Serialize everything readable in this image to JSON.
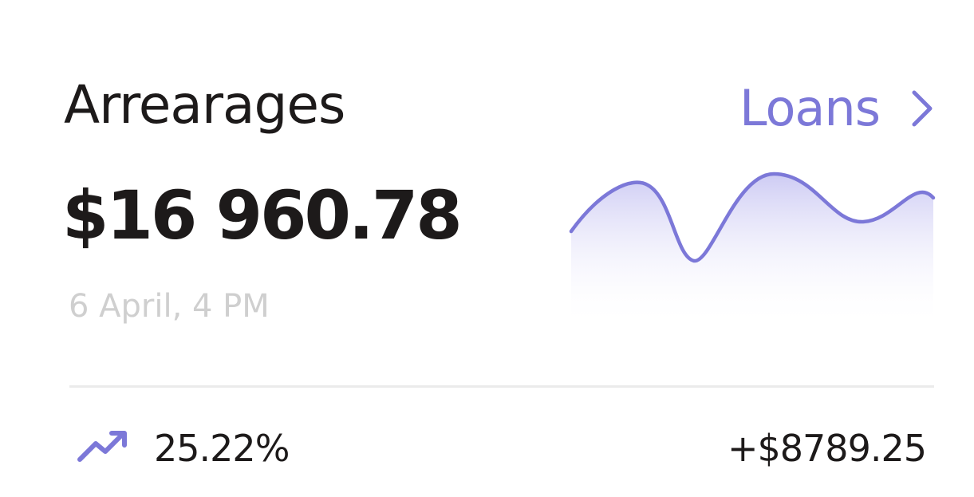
{
  "card": {
    "title": "Arrearages",
    "link_label": "Loans",
    "link_icon": "chevron-right-icon",
    "amount": "$16 960.78",
    "timestamp": "6 April, 4 PM",
    "change_icon": "trending-up-icon",
    "change_percent": "25.22%",
    "change_amount": "+$8789.25"
  },
  "colors": {
    "accent": "#7c78d8",
    "text": "#1d1a1a",
    "muted": "#cfcfcf",
    "divider": "#ebebeb"
  }
}
